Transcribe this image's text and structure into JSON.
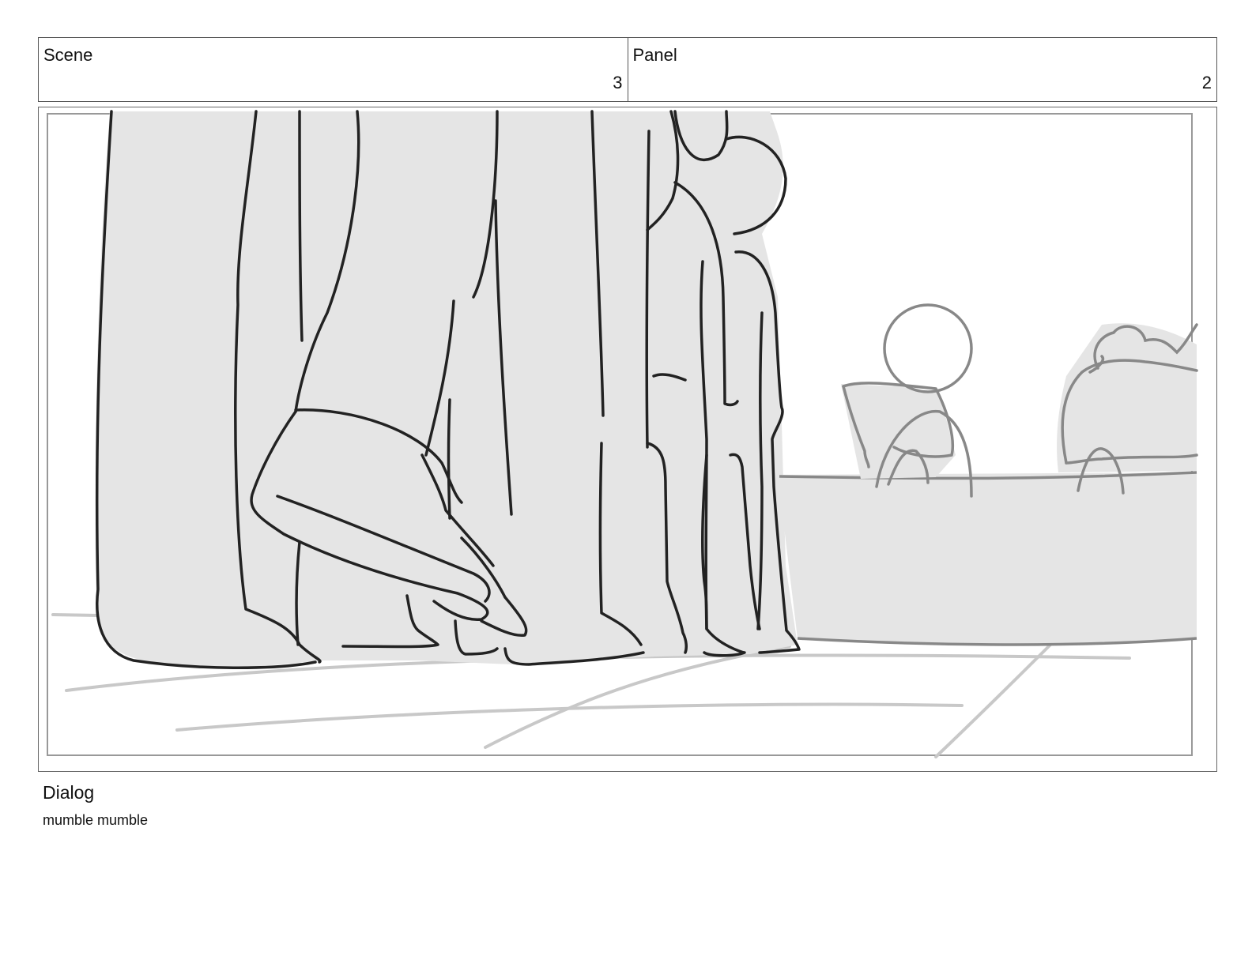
{
  "header": {
    "scene_label": "Scene",
    "scene_value": "3",
    "panel_label": "Panel",
    "panel_value": "2"
  },
  "dialog": {
    "label": "Dialog",
    "text": "mumble mumble"
  },
  "colors": {
    "border": "#555555",
    "sketch_fill": "#e5e5e5",
    "ink_dark": "#222222",
    "ink_mid": "#888888",
    "ink_light": "#c8c8c8"
  }
}
